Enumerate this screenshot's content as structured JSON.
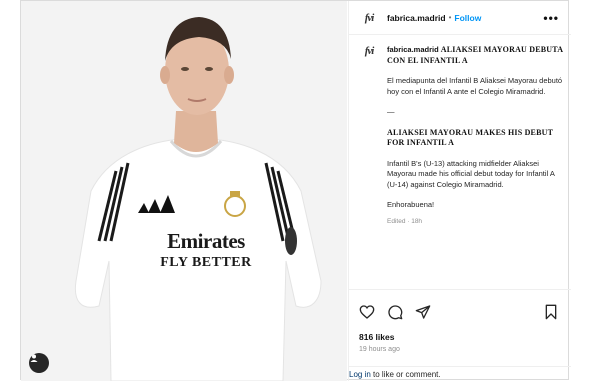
{
  "post": {
    "username": "fabrica.madrid",
    "follow_label": "Follow",
    "dot": "•",
    "more": "•••",
    "logo_text": "fvi"
  },
  "caption": {
    "username": "fabrica.madrid",
    "title_es": "ALIAKSEI MAYORAU DEBUTA CON EL INFANTIL A",
    "text_es": "El mediapunta del Infantil B Aliaksei Mayorau debutó hoy con el Infantil A ante el Colegio Miramadrid.",
    "divider": "—",
    "title_en": "ALIAKSEI MAYORAU MAKES HIS DEBUT FOR INFANTIL A",
    "text_en": "Infantil B's (U-13) attacking midfielder Aliaksei Mayorau made his official debut today for Infantil A (U-14) against Colegio Miramadrid.",
    "closing": "Enhorabuena!",
    "meta": "Edited · 18h"
  },
  "photo": {
    "sponsor_line1": "Emirates",
    "sponsor_line2": "FLY BETTER"
  },
  "stats": {
    "likes": "816 likes",
    "time": "19 hours ago"
  },
  "footer": {
    "login_link": "Log in",
    "login_text": " to like or comment."
  },
  "icons": [
    "heart-icon",
    "comment-icon",
    "share-icon",
    "bookmark-icon",
    "add-comment-icon",
    "user-tag-icon"
  ]
}
